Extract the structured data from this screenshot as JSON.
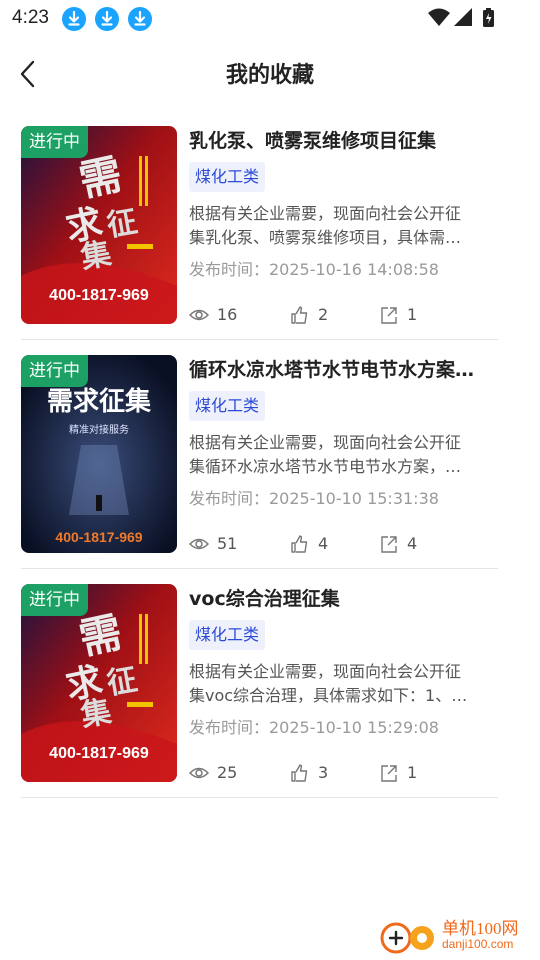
{
  "status_bar": {
    "time": "4:23",
    "icons": [
      "download-icon",
      "download-icon",
      "download-icon",
      "wifi-icon",
      "signal-icon",
      "battery-charging-icon"
    ]
  },
  "header": {
    "title": "我的收藏",
    "back_icon": "back-arrow-icon"
  },
  "items": [
    {
      "badge": "进行中",
      "title": "乳化泵、喷雾泵维修项目征集",
      "tag": "煤化工类",
      "desc_line1": "根据有关企业需要，现面向社会公开征",
      "desc_line2": "集乳化泵、喷雾泵维修项目，具体需…",
      "published": "发布时间：2025-10-16 14:08:58",
      "views": "16",
      "likes": "2",
      "shares": "1",
      "thumb": {
        "style": "red",
        "phone": "400-1817-969"
      }
    },
    {
      "badge": "进行中",
      "title": "循环水凉水塔节水节电节水方案…",
      "tag": "煤化工类",
      "desc_line1": "根据有关企业需要，现面向社会公开征",
      "desc_line2": "集循环水凉水塔节水节电节水方案，…",
      "published": "发布时间：2025-10-10 15:31:38",
      "views": "51",
      "likes": "4",
      "shares": "4",
      "thumb": {
        "style": "dark",
        "heading": "需求征集",
        "sub": "精准对接服务",
        "phone": "400-1817-969"
      }
    },
    {
      "badge": "进行中",
      "title": "voc综合治理征集",
      "tag": "煤化工类",
      "desc_line1": "根据有关企业需要，现面向社会公开征",
      "desc_line2": "集voc综合治理，具体需求如下：1、…",
      "published": "发布时间：2025-10-10 15:29:08",
      "views": "25",
      "likes": "3",
      "shares": "1",
      "thumb": {
        "style": "red",
        "phone": "400-1817-969"
      }
    }
  ],
  "watermark": {
    "name": "单机100网",
    "url": "danji100.com"
  },
  "colors": {
    "badge": "#1ca063",
    "tag_bg": "#eef0fb",
    "tag_text": "#2d4bd8",
    "watermark": "#f06a1c",
    "status_download": "#1aa3ff"
  }
}
